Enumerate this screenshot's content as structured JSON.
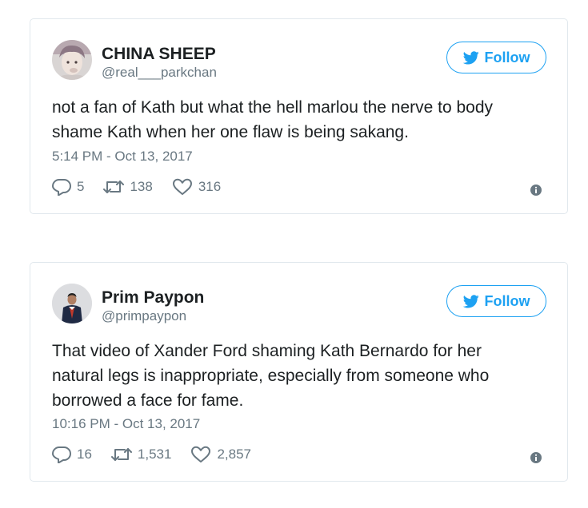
{
  "tweets": [
    {
      "display_name": "CHINA SHEEP",
      "handle": "@real___parkchan",
      "follow_label": "Follow",
      "text": "not a fan of Kath but what the hell marlou the nerve to body shame Kath when her one flaw is being sakang.",
      "timestamp": "5:14 PM - Oct 13, 2017",
      "replies": "5",
      "retweets": "138",
      "likes": "316"
    },
    {
      "display_name": "Prim Paypon",
      "handle": "@primpaypon",
      "follow_label": "Follow",
      "text": "That video of Xander Ford shaming Kath Bernardo for her natural legs is inappropriate, especially from someone who borrowed a face for fame.",
      "timestamp": "10:16 PM - Oct 13, 2017",
      "replies": "16",
      "retweets": "1,531",
      "likes": "2,857"
    }
  ],
  "colors": {
    "accent": "#1da1f2",
    "muted": "#697882",
    "text": "#1c2022",
    "border": "#e1e8ed"
  },
  "icons": {
    "reply": "reply-icon",
    "retweet": "retweet-icon",
    "like": "heart-icon",
    "info": "info-icon",
    "follow": "twitter-bird-icon"
  }
}
